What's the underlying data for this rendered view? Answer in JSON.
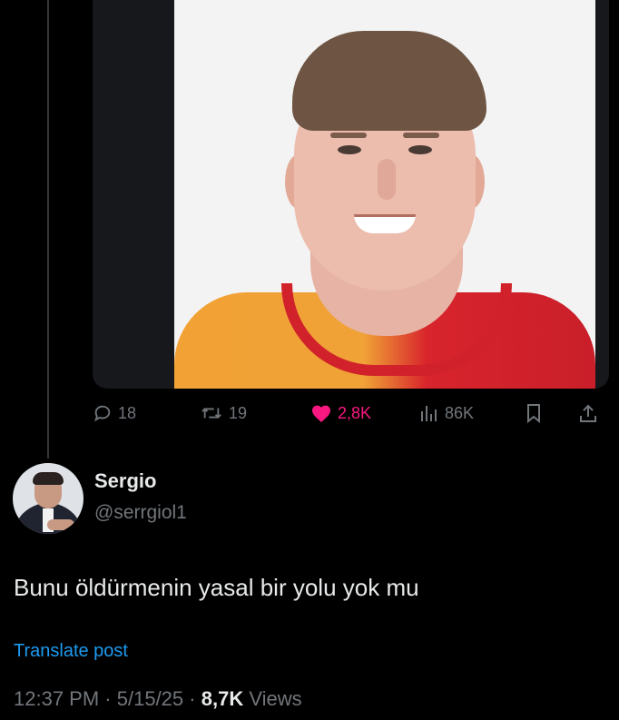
{
  "actions": {
    "replies": "18",
    "reposts": "19",
    "likes": "2,8K",
    "views": "86K"
  },
  "reply_tweet": {
    "display_name": "Sergio",
    "handle": "@serrgiol1",
    "text": "Bunu öldürmenin yasal bir yolu yok mu",
    "translate_label": "Translate post",
    "time": "12:37 PM",
    "date": "5/15/25",
    "views_count": "8,7K",
    "views_label": "Views",
    "separator": "·"
  },
  "colors": {
    "background": "#000000",
    "text": "#e7e9ea",
    "muted": "#71767b",
    "link": "#1d9bf0",
    "like": "#f91880"
  },
  "icons": [
    "reply-icon",
    "repost-icon",
    "heart-icon",
    "views-icon",
    "bookmark-icon",
    "share-icon"
  ]
}
